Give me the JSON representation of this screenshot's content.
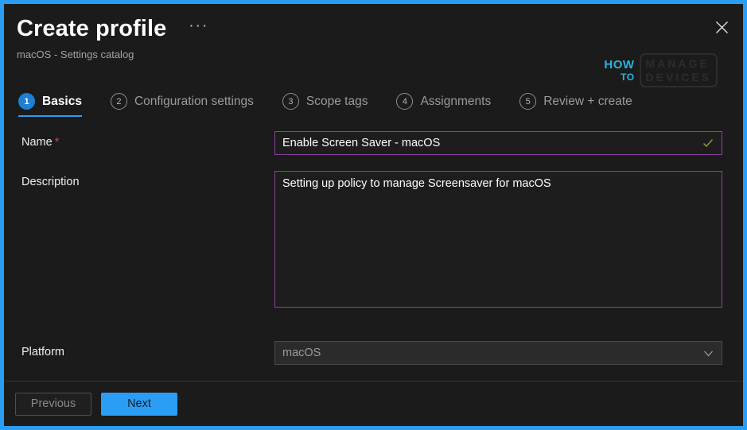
{
  "window": {
    "title": "Create profile",
    "subtitle": "macOS - Settings catalog",
    "overflow_menu": "···",
    "close_icon": "close-icon",
    "accent_color": "#2a9df4",
    "border_color": "#2a9df4"
  },
  "logo": {
    "how": "HOW",
    "to": "TO",
    "manage": "MANAGE",
    "devices": "DEVICES",
    "accent": "#29bcea"
  },
  "tabs": [
    {
      "number": "1",
      "label": "Basics",
      "active": true
    },
    {
      "number": "2",
      "label": "Configuration settings",
      "active": false
    },
    {
      "number": "3",
      "label": "Scope tags",
      "active": false
    },
    {
      "number": "4",
      "label": "Assignments",
      "active": false
    },
    {
      "number": "5",
      "label": "Review + create",
      "active": false
    }
  ],
  "form": {
    "name": {
      "label": "Name",
      "required_marker": "*",
      "value": "Enable Screen Saver - macOS",
      "placeholder": "",
      "valid_icon": "check-icon",
      "valid_color": "#8a9a3a",
      "border_color": "#8d3f9e"
    },
    "description": {
      "label": "Description",
      "value": "Setting up policy to manage Screensaver for macOS",
      "placeholder": "",
      "border_color": "#8d3f9e"
    },
    "platform": {
      "label": "Platform",
      "value": "macOS",
      "disabled": true,
      "chevron_icon": "chevron-down-icon",
      "options": [
        "macOS"
      ]
    }
  },
  "footer": {
    "previous_label": "Previous",
    "previous_disabled": true,
    "next_label": "Next",
    "next_color": "#2a9df4"
  }
}
